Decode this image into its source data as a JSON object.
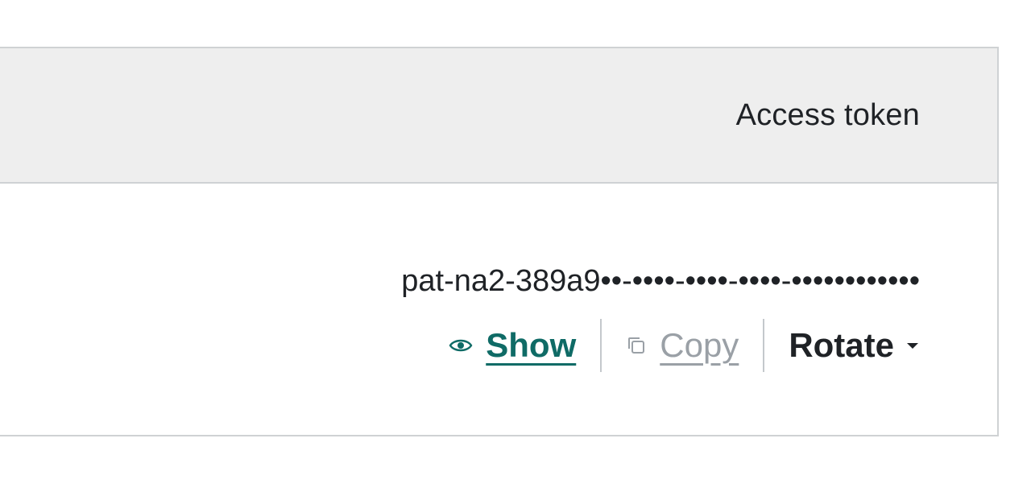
{
  "table": {
    "header": {
      "access_token_label": "Access token"
    },
    "row": {
      "token_value": "pat-na2-389a9••-••••-••••-••••-••••••••••••",
      "actions": {
        "show_label": "Show",
        "show_icon": "eye-icon",
        "copy_label": "Copy",
        "copy_icon": "copy-icon",
        "rotate_label": "Rotate",
        "rotate_icon": "caret-down-icon"
      }
    }
  },
  "colors": {
    "link_teal": "#0f6b66",
    "disabled_gray": "#9aa0a6",
    "header_bg": "#eeeeee",
    "border": "#cfd2d4",
    "text": "#1f2226"
  }
}
